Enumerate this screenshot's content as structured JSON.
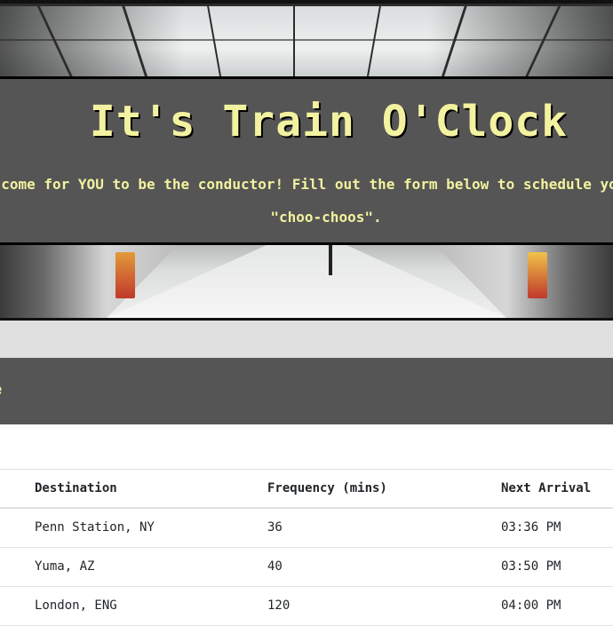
{
  "header": {
    "title": "It's Train O'Clock",
    "lead_line1": "The time has come for YOU to be the conductor! Fill out the form below to schedule your",
    "lead_line2": "\"choo-choos\"."
  },
  "panel": {
    "heading": "e"
  },
  "schedule": {
    "columns": [
      "Destination",
      "Frequency (mins)",
      "Next Arrival"
    ],
    "rows": [
      {
        "destination": "Penn Station, NY",
        "frequency": "36",
        "next_arrival": "03:36 PM"
      },
      {
        "destination": "Yuma, AZ",
        "frequency": "40",
        "next_arrival": "03:50 PM"
      },
      {
        "destination": "London, ENG",
        "frequency": "120",
        "next_arrival": "04:00 PM"
      }
    ]
  },
  "colors": {
    "banner_bg": "#555555",
    "accent_text": "#f2f2a0",
    "strip_bg": "#e0e0e0"
  }
}
